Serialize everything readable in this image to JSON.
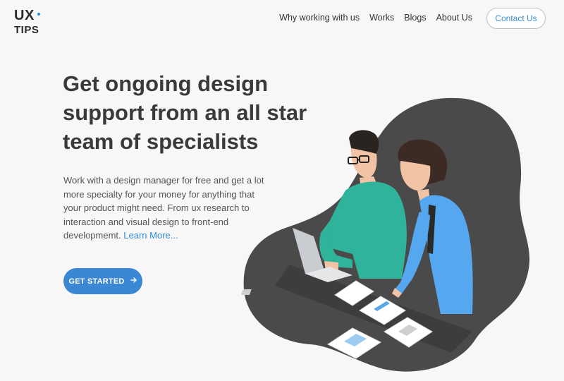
{
  "logo": {
    "line1": "UX",
    "line2": "TIPS"
  },
  "nav": {
    "items": [
      "Why working with us",
      "Works",
      "Blogs",
      "About Us"
    ],
    "contact": "Contact Us"
  },
  "hero": {
    "title": "Get ongoing design support from an all star team of specialists",
    "description": "Work with a design manager for free and get a lot more specialty for your money for anything that your product might need. From ux research to interaction and visual design to front-end developmemt.",
    "learn_more": "Learn More...",
    "cta": "GET STARTED",
    "cta_icon": "arrow-right-icon"
  },
  "colors": {
    "accent": "#3b87d4",
    "blob": "#4a4a4a",
    "shirt_teal": "#2fb39a",
    "shirt_blue": "#55a8ef"
  },
  "illustration": {
    "subject": "two-designers-reviewing-wireframes"
  }
}
